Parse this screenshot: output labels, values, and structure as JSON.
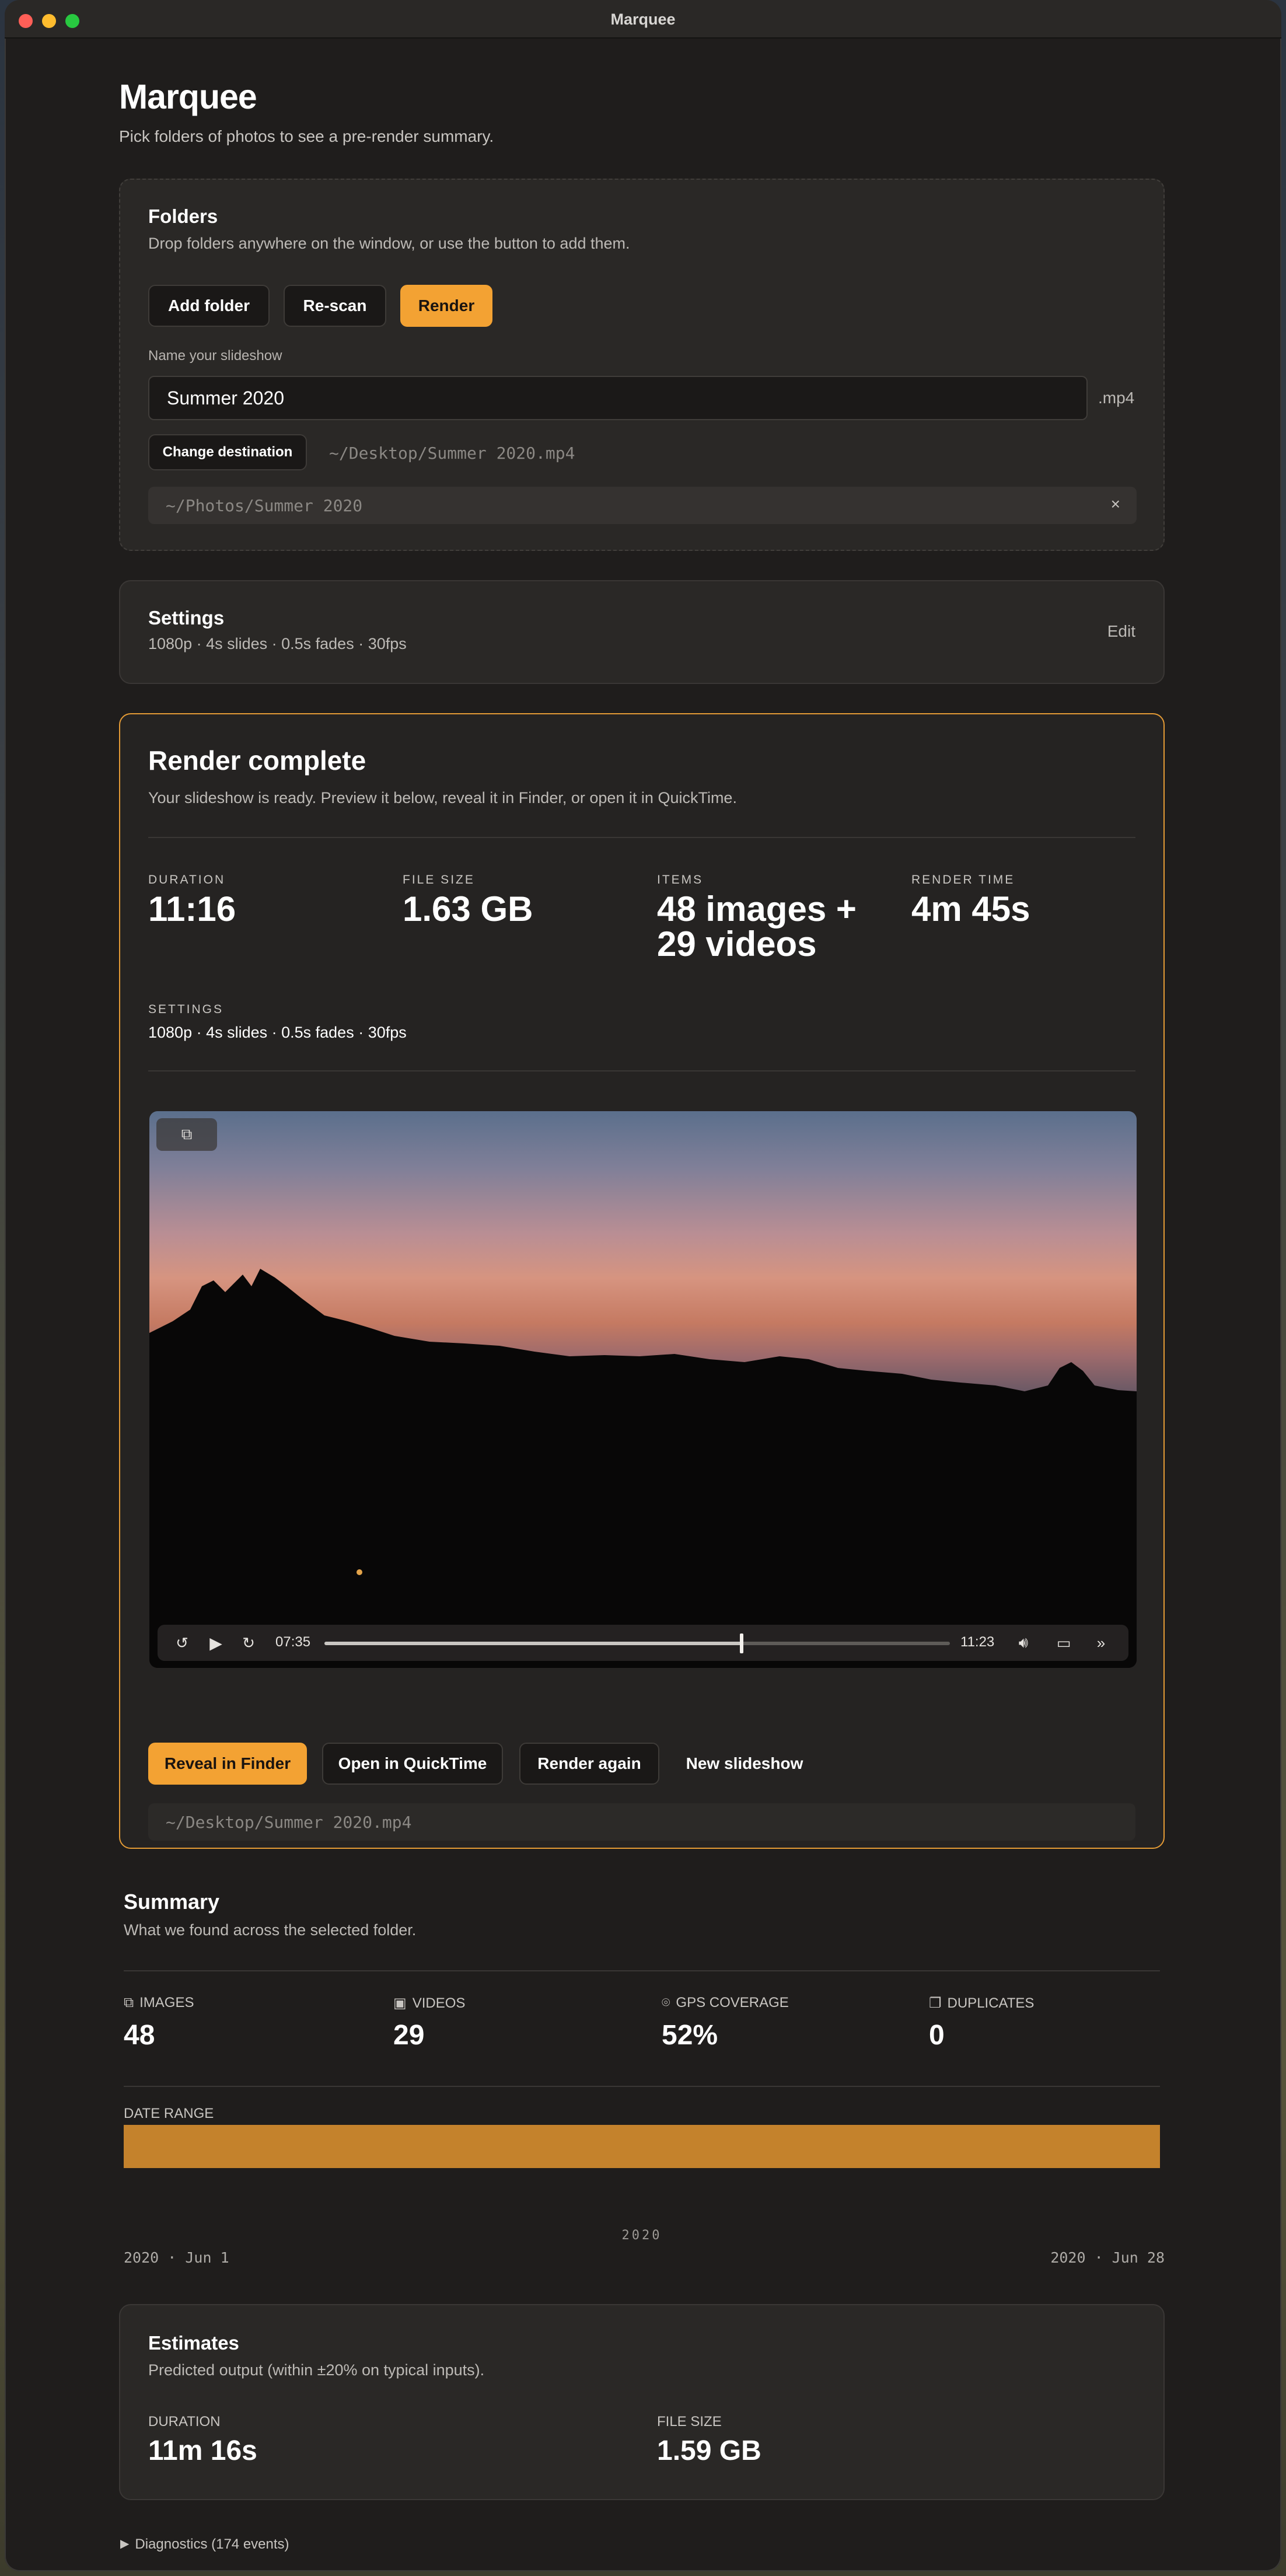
{
  "window": {
    "title": "Marquee"
  },
  "header": {
    "title": "Marquee",
    "subtitle": "Pick folders of photos to see a pre-render summary."
  },
  "folders": {
    "title": "Folders",
    "hint": "Drop folders anywhere on the window, or use the button to add them.",
    "add_label": "Add folder",
    "rescan_label": "Re-scan",
    "render_label": "Render",
    "name_label": "Name your slideshow",
    "name_value": "Summer 2020",
    "extension": ".mp4",
    "change_dest_label": "Change destination",
    "dest_path": "~/Desktop/Summer 2020.mp4",
    "folder_path": "~/Photos/Summer 2020",
    "remove_glyph": "×"
  },
  "settings": {
    "title": "Settings",
    "summary": "1080p · 4s slides · 0.5s fades · 30fps",
    "edit_label": "Edit"
  },
  "render": {
    "title": "Render complete",
    "subtitle": "Your slideshow is ready. Preview it below, reveal it in Finder, or open it in QuickTime.",
    "stats": [
      {
        "label": "DURATION",
        "value": "11:16"
      },
      {
        "label": "FILE SIZE",
        "value": "1.63 GB"
      },
      {
        "label": "ITEMS",
        "value": "48 images + 29 videos"
      },
      {
        "label": "RENDER TIME",
        "value": "4m 45s"
      }
    ],
    "settings_label": "SETTINGS",
    "settings_value": "1080p · 4s slides · 0.5s fades · 30fps",
    "player": {
      "current_time": "07:35",
      "total_time": "11:23",
      "progress": 0.667,
      "skip_back": "15",
      "skip_forward": "15"
    },
    "reveal_label": "Reveal in Finder",
    "quicktime_label": "Open in QuickTime",
    "render_again_label": "Render again",
    "new_label": "New slideshow",
    "output_path": "~/Desktop/Summer 2020.mp4"
  },
  "summary": {
    "title": "Summary",
    "subtitle": "What we found across the selected folder.",
    "items": [
      {
        "label": "IMAGES",
        "value": "48",
        "icon": "images-icon"
      },
      {
        "label": "VIDEOS",
        "value": "29",
        "icon": "film-icon"
      },
      {
        "label": "GPS COVERAGE",
        "value": "52%",
        "icon": "location-pin-icon"
      },
      {
        "label": "DUPLICATES",
        "value": "0",
        "icon": "duplicate-icon"
      }
    ],
    "date_range_label": "DATE RANGE",
    "year_label": "2020",
    "range_start": "2020 · Jun 1",
    "range_end": "2020 · Jun 28",
    "accent": "#c4822c"
  },
  "estimates": {
    "title": "Estimates",
    "subtitle": "Predicted output (within ±20% on typical inputs).",
    "duration_label": "DURATION",
    "duration_value": "11m 16s",
    "size_label": "FILE SIZE",
    "size_value": "1.59 GB"
  },
  "diagnostics": {
    "label": "Diagnostics (174 events)",
    "toggle_glyph": "▶"
  },
  "colors": {
    "accent": "#f3a233",
    "background": "#1f1d1c",
    "card": "#2a2826"
  }
}
